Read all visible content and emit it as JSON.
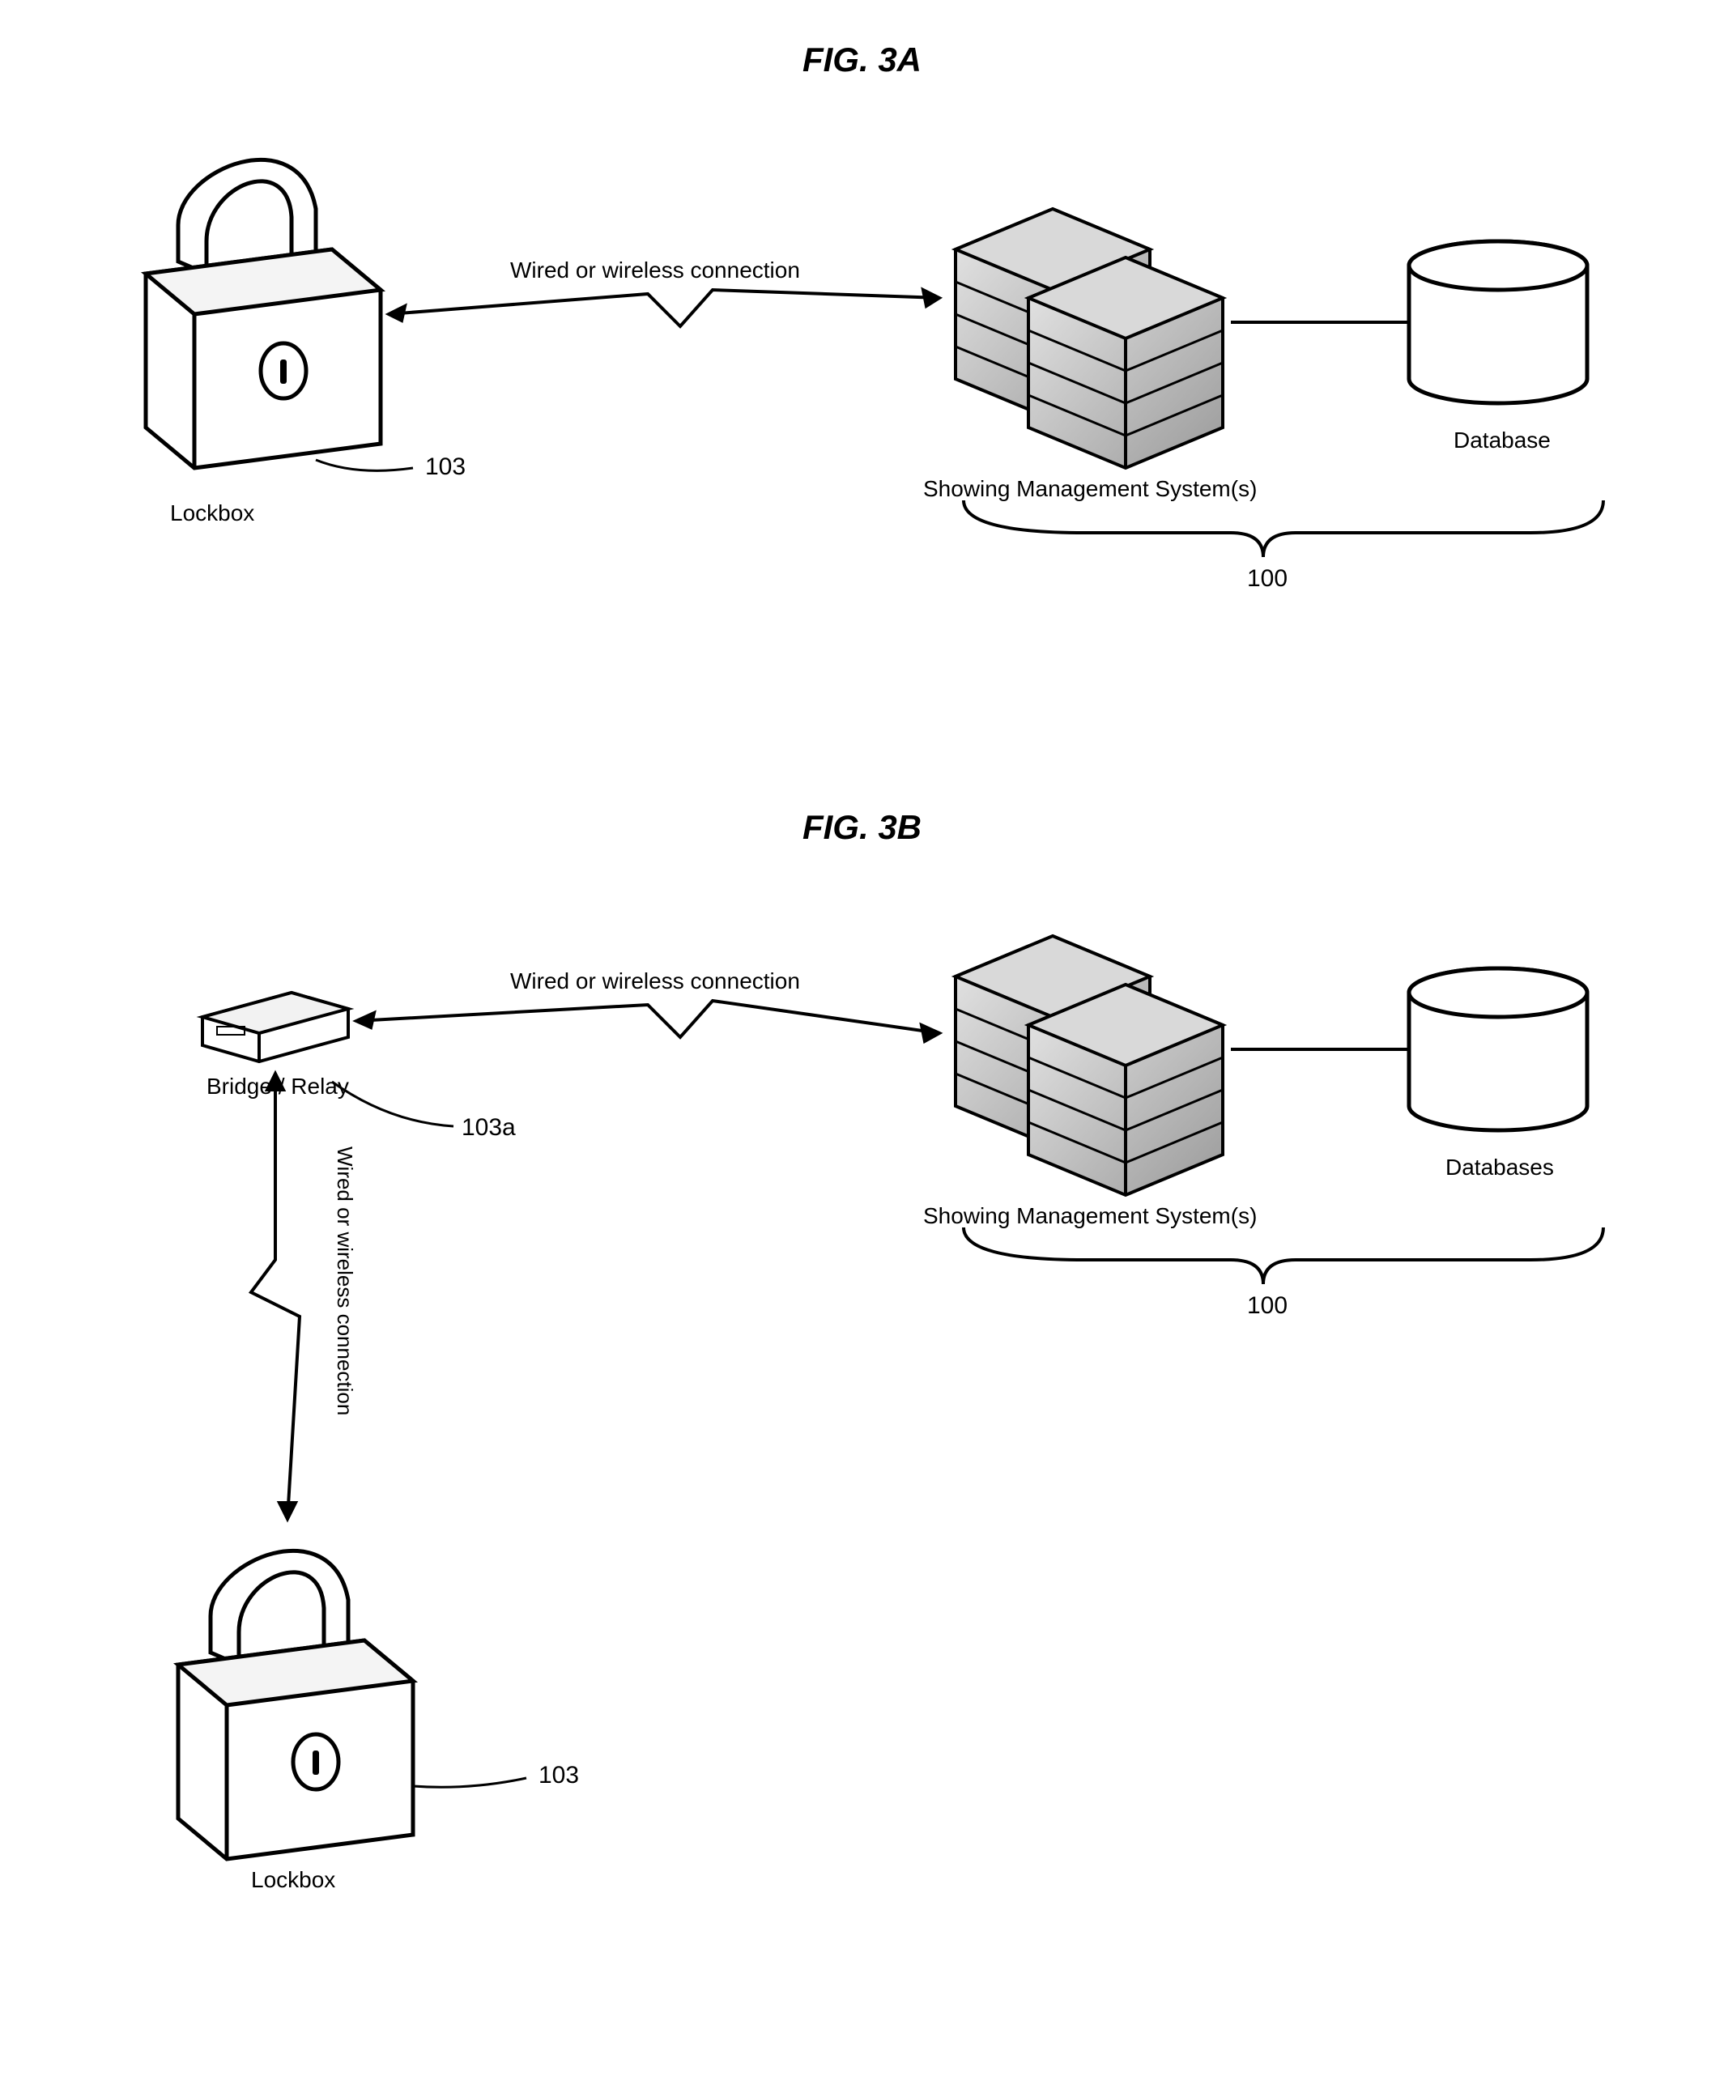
{
  "figA": {
    "title": "FIG. 3A",
    "lockbox_label": "Lockbox",
    "lockbox_ref": "103",
    "conn_label": "Wired or wireless connection",
    "sms_label": "Showing Management System(s)",
    "db_label": "Database",
    "group_ref": "100"
  },
  "figB": {
    "title": "FIG. 3B",
    "bridge_label": "Bridge / Relay",
    "bridge_ref": "103a",
    "conn_label_top": "Wired or wireless connection",
    "conn_label_left": "Wired or wireless connection",
    "sms_label": "Showing Management System(s)",
    "db_label": "Databases",
    "group_ref": "100",
    "lockbox_label": "Lockbox",
    "lockbox_ref": "103"
  }
}
